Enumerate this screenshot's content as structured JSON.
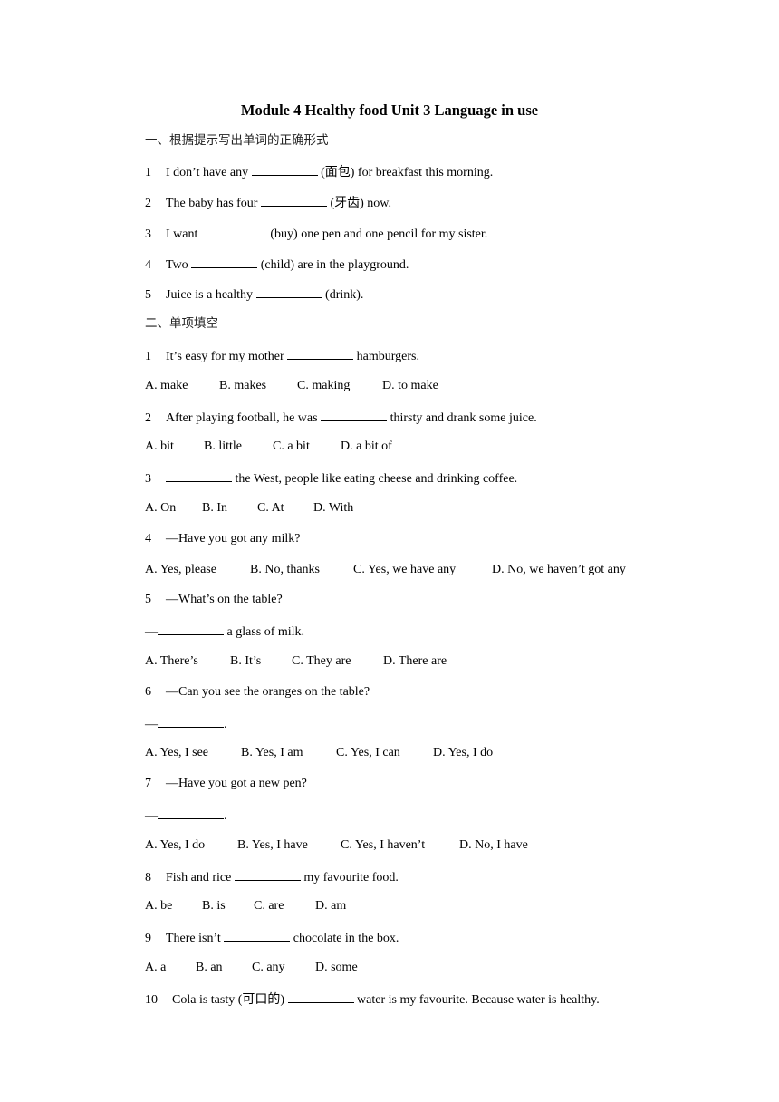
{
  "title": "Module 4 Healthy food Unit 3 Language in use",
  "section1": {
    "heading": "一、根据提示写出单词的正确形式",
    "items": [
      {
        "num": "1",
        "before": "I don’t have any ",
        "after": " (面包) for breakfast this morning."
      },
      {
        "num": "2",
        "before": "The baby has four ",
        "after": " (牙齿) now."
      },
      {
        "num": "3",
        "before": "I want ",
        "after": " (buy) one pen and one pencil for my sister."
      },
      {
        "num": "4",
        "before": "Two ",
        "after": " (child) are in the playground."
      },
      {
        "num": "5",
        "before": "Juice is a healthy ",
        "after": " (drink)."
      }
    ]
  },
  "section2": {
    "heading": "二、单项填空",
    "questions": [
      {
        "num": "1",
        "before": "It’s easy for my mother ",
        "after": " hamburgers.",
        "options": [
          "A. make",
          "B. makes",
          "C. making",
          "D. to make"
        ]
      },
      {
        "num": "2",
        "before": "After playing football, he was ",
        "after": " thirsty and drank some juice.",
        "options": [
          "A. bit",
          "B. little",
          "C. a bit",
          "D. a bit of"
        ]
      },
      {
        "num": "3",
        "before": "",
        "after": " the West, people like eating cheese and drinking coffee.",
        "options": [
          "A. On",
          "B. In",
          "C. At",
          "D. With"
        ]
      },
      {
        "num": "4",
        "text": "—Have you got any milk?",
        "options": [
          "A. Yes, please",
          "B. No, thanks",
          "C. Yes, we have any",
          "D. No, we haven’t got any"
        ]
      },
      {
        "num": "5",
        "text": "—What’s on the table?",
        "answer_before": "—",
        "answer_after": " a glass of milk.",
        "options": [
          "A. There’s",
          "B. It’s",
          "C. They are",
          "D. There are"
        ]
      },
      {
        "num": "6",
        "text": "—Can you see the oranges on the table?",
        "answer_before": "—",
        "answer_after": ".",
        "options": [
          "A. Yes, I see",
          "B. Yes, I am",
          "C. Yes, I can",
          "D. Yes, I do"
        ]
      },
      {
        "num": "7",
        "text": "—Have you got a new pen?",
        "answer_before": "—",
        "answer_after": ".",
        "options": [
          "A. Yes, I do",
          "B. Yes, I have",
          "C. Yes, I haven’t",
          "D. No, I have"
        ]
      },
      {
        "num": "8",
        "before": "Fish and rice ",
        "after": " my favourite food.",
        "options": [
          "A. be",
          "B. is",
          "C. are",
          "D. am"
        ]
      },
      {
        "num": "9",
        "before": "There isn’t ",
        "after": " chocolate in the box.",
        "options": [
          "A. a",
          "B. an",
          "C. any",
          "D. some"
        ]
      },
      {
        "num": "10",
        "before": "Cola is tasty (可口的) ",
        "after": " water is my favourite. Because water is healthy."
      }
    ]
  }
}
